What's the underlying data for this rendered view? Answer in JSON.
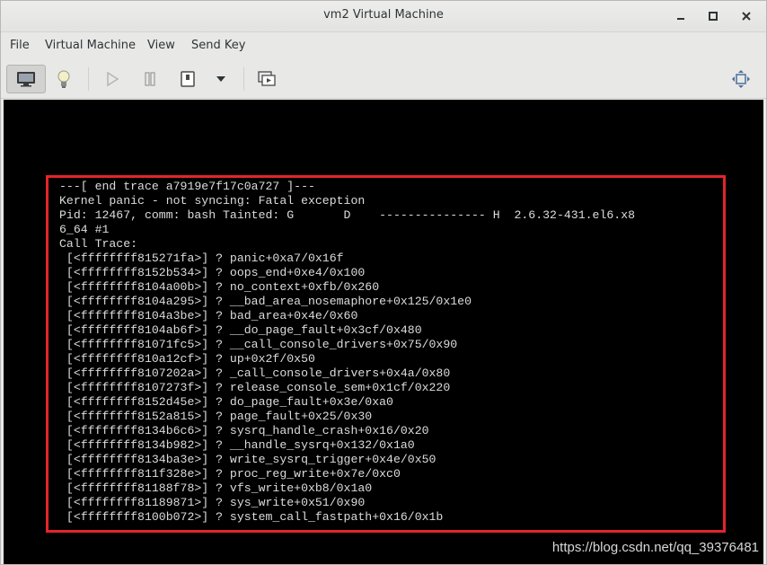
{
  "window": {
    "title": "vm2 Virtual Machine",
    "controls": {
      "minimize": "–",
      "maximize": "□",
      "close": "✕"
    }
  },
  "menu": {
    "items": [
      "File",
      "Virtual Machine",
      "View",
      "Send Key"
    ]
  },
  "toolbar": {
    "buttons": [
      {
        "name": "console-icon",
        "active": true
      },
      {
        "name": "details-icon",
        "active": false
      },
      {
        "name": "run-icon",
        "active": false
      },
      {
        "name": "pause-icon",
        "active": false
      },
      {
        "name": "shutdown-icon",
        "active": false
      },
      {
        "name": "shutdown-menu-chevron-icon",
        "active": false
      },
      {
        "name": "snapshots-icon",
        "active": false
      },
      {
        "name": "fullscreen-icon",
        "active": false
      }
    ]
  },
  "console": {
    "lines": [
      "---[ end trace a7919e7f17c0a727 ]---",
      "Kernel panic - not syncing: Fatal exception",
      "Pid: 12467, comm: bash Tainted: G       D    --------------- H  2.6.32-431.el6.x8",
      "6_64 #1",
      "Call Trace:",
      " [<ffffffff815271fa>] ? panic+0xa7/0x16f",
      " [<ffffffff8152b534>] ? oops_end+0xe4/0x100",
      " [<ffffffff8104a00b>] ? no_context+0xfb/0x260",
      " [<ffffffff8104a295>] ? __bad_area_nosemaphore+0x125/0x1e0",
      " [<ffffffff8104a3be>] ? bad_area+0x4e/0x60",
      " [<ffffffff8104ab6f>] ? __do_page_fault+0x3cf/0x480",
      " [<ffffffff81071fc5>] ? __call_console_drivers+0x75/0x90",
      " [<ffffffff810a12cf>] ? up+0x2f/0x50",
      " [<ffffffff8107202a>] ? _call_console_drivers+0x4a/0x80",
      " [<ffffffff8107273f>] ? release_console_sem+0x1cf/0x220",
      " [<ffffffff8152d45e>] ? do_page_fault+0x3e/0xa0",
      " [<ffffffff8152a815>] ? page_fault+0x25/0x30",
      " [<ffffffff8134b6c6>] ? sysrq_handle_crash+0x16/0x20",
      " [<ffffffff8134b982>] ? __handle_sysrq+0x132/0x1a0",
      " [<ffffffff8134ba3e>] ? write_sysrq_trigger+0x4e/0x50",
      " [<ffffffff811f328e>] ? proc_reg_write+0x7e/0xc0",
      " [<ffffffff81188f78>] ? vfs_write+0xb8/0x1a0",
      " [<ffffffff81189871>] ? sys_write+0x51/0x90",
      " [<ffffffff8100b072>] ? system_call_fastpath+0x16/0x1b"
    ]
  },
  "watermark": "https://blog.csdn.net/qq_39376481",
  "colors": {
    "highlight_box": "#e4242a",
    "console_bg": "#000000",
    "console_text": "#dcdcdc",
    "chrome_bg": "#e8e8e7"
  }
}
